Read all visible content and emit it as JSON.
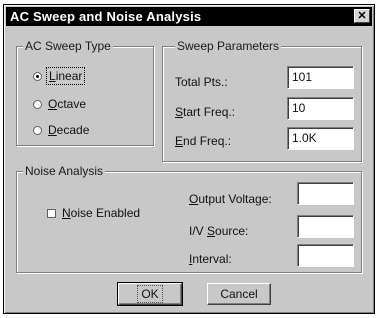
{
  "window": {
    "title": "AC Sweep and Noise Analysis",
    "close_glyph": "✕"
  },
  "sweep_type": {
    "legend": "AC Sweep Type",
    "options": [
      {
        "first": "L",
        "rest": "inear",
        "selected": true
      },
      {
        "first": "O",
        "rest": "ctave",
        "selected": false
      },
      {
        "first": "D",
        "rest": "ecade",
        "selected": false
      }
    ]
  },
  "sweep_params": {
    "legend": "Sweep Parameters",
    "total_pts": {
      "label": "Total Pts.:",
      "value": "101"
    },
    "start_freq": {
      "first": "S",
      "rest": "tart Freq.:",
      "value": "10"
    },
    "end_freq": {
      "first": "E",
      "rest": "nd Freq.:",
      "value": "1.0K"
    }
  },
  "noise": {
    "legend": "Noise Analysis",
    "enabled": {
      "first": "N",
      "rest": "oise Enabled",
      "checked": false
    },
    "output_voltage": {
      "first": "O",
      "rest": "utput Voltage:",
      "value": ""
    },
    "iv_source": {
      "pre": "I/V ",
      "first": "S",
      "rest": "ource:",
      "value": ""
    },
    "interval": {
      "first": "I",
      "rest": "nterval:",
      "value": ""
    }
  },
  "buttons": {
    "ok": "OK",
    "cancel": "Cancel"
  }
}
